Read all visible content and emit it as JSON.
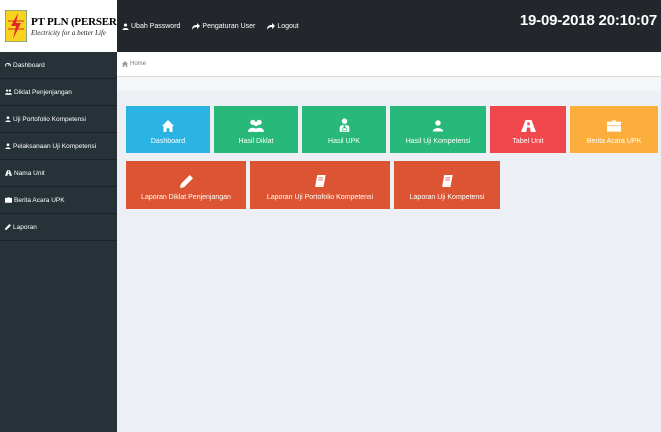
{
  "brand": {
    "name": "PT PLN (PERSERO)",
    "tagline": "Electricity for a better Life",
    "logo_colors": {
      "bg": "#f7d21e",
      "bolt": "#e32726"
    }
  },
  "topbar": {
    "links": [
      {
        "label": "Ubah Password",
        "icon": "user-icon"
      },
      {
        "label": "Pengaturan User",
        "icon": "share-icon"
      },
      {
        "label": "Logout",
        "icon": "share-icon"
      }
    ],
    "datetime": "19-09-2018 20:10:07"
  },
  "sidebar": {
    "items": [
      {
        "label": "Dashboard",
        "icon": "dashboard-icon"
      },
      {
        "label": "Diklat Penjenjangan",
        "icon": "users-icon"
      },
      {
        "label": "Uji Portofolio Kompetensi",
        "icon": "user-icon"
      },
      {
        "label": "Pelaksanaan Uji Kompetensi",
        "icon": "user-icon"
      },
      {
        "label": "Nama Unit",
        "icon": "road-icon"
      },
      {
        "label": "Berita Acara UPK",
        "icon": "briefcase-icon"
      },
      {
        "label": "Laporan",
        "icon": "pencil-icon"
      }
    ]
  },
  "breadcrumb": {
    "home": "Home"
  },
  "tiles": {
    "row1": [
      {
        "label": "Dashboard",
        "icon": "home-icon",
        "color": "#2bb3e3"
      },
      {
        "label": "Hasil Diklat",
        "icon": "users-icon",
        "color": "#27b87a"
      },
      {
        "label": "Hasil UPK",
        "icon": "user-tie-icon",
        "color": "#27b87a"
      },
      {
        "label": "Hasil Uji Kompetensi",
        "icon": "user-icon",
        "color": "#27b87a"
      },
      {
        "label": "Tabel Unit",
        "icon": "road-icon",
        "color": "#f0474d"
      },
      {
        "label": "Berita Acara UPK",
        "icon": "briefcase-icon",
        "color": "#fbae3c"
      }
    ],
    "row2": [
      {
        "label": "Laporan Diklat Penjenjangan",
        "icon": "pencil-icon",
        "color": "#dc5431"
      },
      {
        "label": "Laporan Uji Portofolio Kompetensi",
        "icon": "book-icon",
        "color": "#dc5431"
      },
      {
        "label": "Laporan Uji Kompetensi",
        "icon": "book-icon",
        "color": "#dc5431"
      }
    ]
  }
}
